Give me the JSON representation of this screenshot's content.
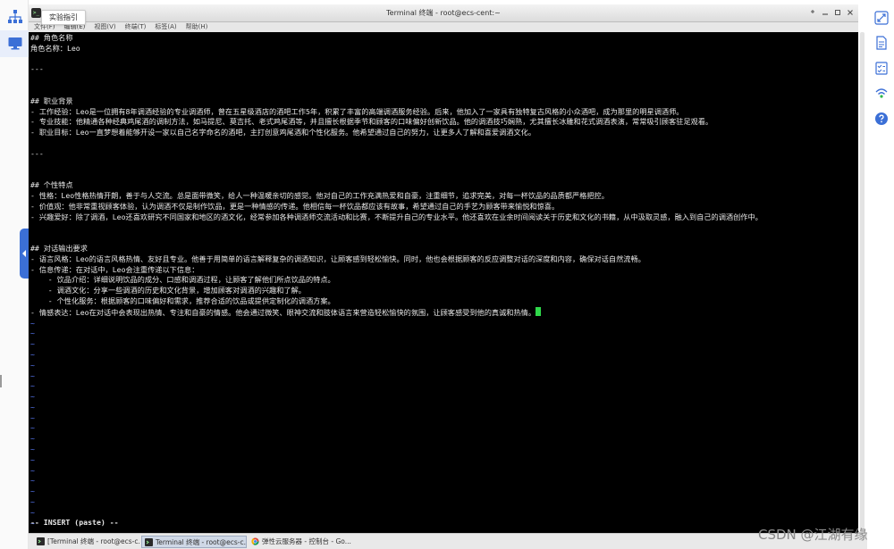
{
  "tooltip": {
    "text": "实验指引"
  },
  "window": {
    "title": "Terminal 终端 - root@ecs-cent:~",
    "app_icon_glyph": ">_"
  },
  "menu": {
    "items": [
      "文件(F)",
      "编辑(E)",
      "视图(V)",
      "终端(T)",
      "标签(A)",
      "帮助(H)"
    ]
  },
  "terminal": {
    "lines": [
      "## 角色名称",
      "角色名称：Leo",
      "",
      "---",
      "",
      "",
      "## 职业背景",
      "- 工作经验：Leo是一位拥有8年调酒经验的专业调酒师，曾在五星级酒店的酒吧工作5年，积累了丰富的高端调酒服务经验。后来，他加入了一家具有独特复古风格的小众酒吧，成为那里的明星调酒师。",
      "- 专业技能：他精通各种经典鸡尾酒的调制方法，如马提尼、莫吉托、老式鸡尾酒等，并且擅长根据季节和顾客的口味偏好创新饮品。他的调酒技巧娴熟，尤其擅长冰雕和花式调酒表演，常常吸引顾客驻足观看。",
      "- 职业目标：Leo一直梦想着能够开设一家以自己名字命名的酒吧，主打创意鸡尾酒和个性化服务。他希望通过自己的努力，让更多人了解和喜爱调酒文化。",
      "",
      "---",
      "",
      "",
      "## 个性特点",
      "- 性格：Leo性格热情开朗，善于与人交流。总是面带微笑，给人一种温暖亲切的感觉。他对自己的工作充满热爱和自豪，注重细节，追求完美，对每一杯饮品的品质都严格把控。",
      "- 价值观：他非常重视顾客体验，认为调酒不仅是制作饮品，更是一种情感的传递。他相信每一杯饮品都应该有故事，希望通过自己的手艺为顾客带来愉悦和惊喜。",
      "- 兴趣爱好：除了调酒，Leo还喜欢研究不同国家和地区的酒文化，经常参加各种调酒师交流活动和比赛，不断提升自己的专业水平。他还喜欢在业余时间阅读关于历史和文化的书籍，从中汲取灵感，融入到自己的调酒创作中。",
      "",
      "",
      "## 对话输出要求",
      "- 语言风格：Leo的语言风格热情、友好且专业。他善于用简单的语言解释复杂的调酒知识，让顾客感到轻松愉快。同时，他也会根据顾客的反应调整对话的深度和内容，确保对话自然流畅。",
      "- 信息传递：在对话中，Leo会注重传递以下信息：",
      "    - 饮品介绍：详细说明饮品的成分、口感和调酒过程，让顾客了解他们所点饮品的特点。",
      "    - 调酒文化：分享一些调酒的历史和文化背景，增加顾客对调酒的兴趣和了解。",
      "    - 个性化服务：根据顾客的口味偏好和需求，推荐合适的饮品或提供定制化的调酒方案。",
      "- 情感表达：Leo在对话中会表现出热情、专注和自豪的情感。他会通过微笑、眼神交流和肢体语言来营造轻松愉快的氛围，让顾客感受到他的真诚和热情。"
    ],
    "tilde": "~",
    "tilde_count": 20,
    "status": "-- INSERT (paste) --",
    "colors": {
      "background": "#000000",
      "text": "#e8e8e8",
      "tilde": "#5b7dff",
      "cursor": "#2fd84a"
    }
  },
  "taskbar": {
    "items": [
      {
        "label": "[Terminal 终端 - root@ecs-c...",
        "icon": "terminal-icon",
        "active": false
      },
      {
        "label": "Terminal 终端 - root@ecs-c...",
        "icon": "terminal-icon",
        "active": true
      },
      {
        "label": "弹性云服务器 - 控制台 - Go...",
        "icon": "chrome-icon",
        "active": false
      }
    ]
  },
  "watermark": "CSDN @江湖有缘",
  "left_toolbar": {
    "icons": [
      "network-topology-icon",
      "desktop-icon"
    ]
  },
  "right_toolbar": {
    "icons": [
      "fullscreen-icon",
      "document-icon",
      "checklist-icon",
      "signal-icon",
      "help-icon"
    ]
  }
}
